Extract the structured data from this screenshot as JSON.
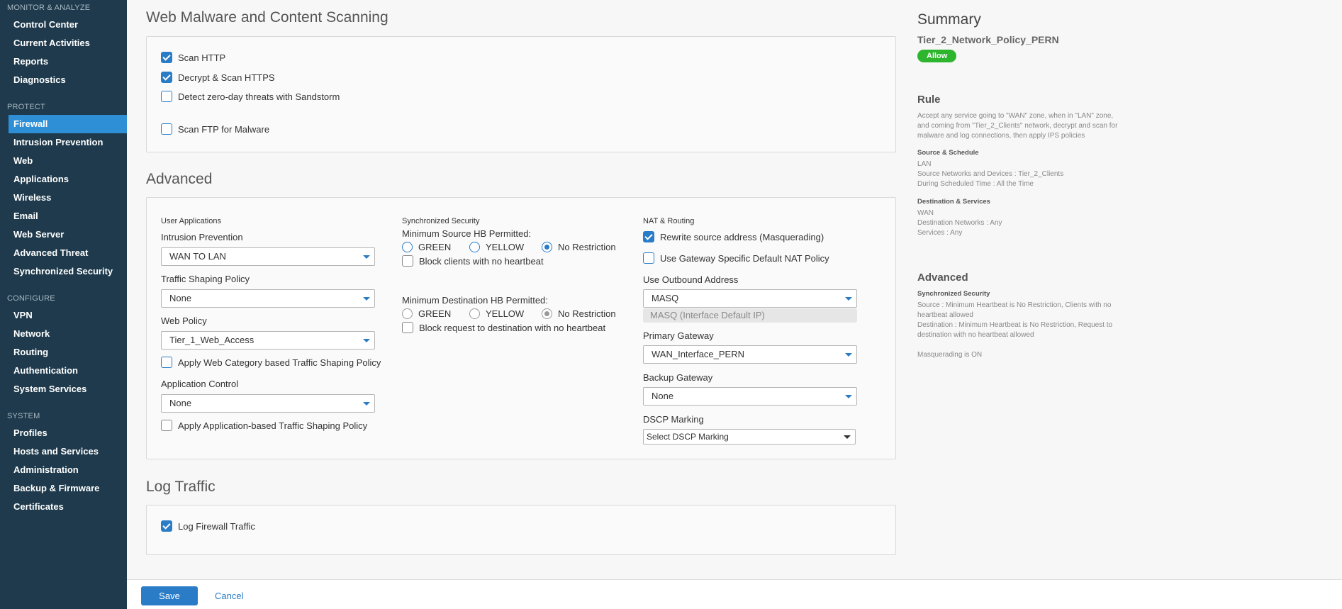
{
  "sidebar": {
    "sections": [
      {
        "title": "MONITOR & ANALYZE",
        "items": [
          "Control Center",
          "Current Activities",
          "Reports",
          "Diagnostics"
        ]
      },
      {
        "title": "PROTECT",
        "items": [
          "Firewall",
          "Intrusion Prevention",
          "Web",
          "Applications",
          "Wireless",
          "Email",
          "Web Server",
          "Advanced Threat",
          "Synchronized Security"
        ]
      },
      {
        "title": "CONFIGURE",
        "items": [
          "VPN",
          "Network",
          "Routing",
          "Authentication",
          "System Services"
        ]
      },
      {
        "title": "SYSTEM",
        "items": [
          "Profiles",
          "Hosts and Services",
          "Administration",
          "Backup & Firmware",
          "Certificates"
        ]
      }
    ],
    "active_item": "Firewall"
  },
  "malware": {
    "title": "Web Malware and Content Scanning",
    "scan_http": {
      "label": "Scan HTTP",
      "checked": true
    },
    "decrypt_https": {
      "label": "Decrypt & Scan HTTPS",
      "checked": true
    },
    "sandstorm": {
      "label": "Detect zero-day threats with Sandstorm",
      "checked": false
    },
    "scan_ftp": {
      "label": "Scan FTP for Malware",
      "checked": false
    }
  },
  "advanced": {
    "title": "Advanced",
    "user_apps": {
      "heading": "User Applications",
      "ips_label": "Intrusion Prevention",
      "ips_value": "WAN TO LAN",
      "shaping_label": "Traffic Shaping Policy",
      "shaping_value": "None",
      "web_policy_label": "Web Policy",
      "web_policy_value": "Tier_1_Web_Access",
      "web_category_shaping": {
        "label": "Apply Web Category based Traffic Shaping Policy",
        "checked": false
      },
      "app_control_label": "Application Control",
      "app_control_value": "None",
      "app_shaping": {
        "label": "Apply Application-based Traffic Shaping Policy",
        "checked": false
      }
    },
    "sync_security": {
      "heading": "Synchronized Security",
      "min_source_label": "Minimum Source HB Permitted:",
      "min_dest_label": "Minimum Destination HB Permitted:",
      "green": "GREEN",
      "yellow": "YELLOW",
      "no_restriction": "No Restriction",
      "block_clients": {
        "label": "Block clients with no heartbeat",
        "checked": false
      },
      "block_request": {
        "label": "Block request to destination with no heartbeat",
        "checked": false
      }
    },
    "nat": {
      "heading": "NAT & Routing",
      "rewrite": {
        "label": "Rewrite source address (Masquerading)",
        "checked": true
      },
      "gateway_nat": {
        "label": "Use Gateway Specific Default NAT Policy",
        "checked": false
      },
      "outbound_label": "Use Outbound Address",
      "outbound_value": "MASQ",
      "outbound_hint": "MASQ (Interface Default IP)",
      "primary_label": "Primary Gateway",
      "primary_value": "WAN_Interface_PERN",
      "backup_label": "Backup Gateway",
      "backup_value": "None",
      "dscp_label": "DSCP Marking",
      "dscp_value": "Select DSCP Marking"
    }
  },
  "log": {
    "title": "Log Traffic",
    "log_firewall": {
      "label": "Log Firewall Traffic",
      "checked": true
    }
  },
  "summary": {
    "title": "Summary",
    "policy_name": "Tier_2_Network_Policy_PERN",
    "badge": "Allow",
    "rule_heading": "Rule",
    "rule_text": "Accept any service going to \"WAN\" zone, when in \"LAN\" zone, and coming from \"Tier_2_Clients\" network, decrypt and scan for malware and log connections, then apply IPS policies",
    "source_heading": "Source & Schedule",
    "source_zone": "LAN",
    "source_networks": "Source Networks and Devices : Tier_2_Clients",
    "schedule": "During Scheduled Time : All the Time",
    "dest_heading": "Destination & Services",
    "dest_zone": "WAN",
    "dest_networks": "Destination Networks : Any",
    "services": "Services : Any",
    "advanced_heading": "Advanced",
    "sync_heading": "Synchronized Security",
    "source_hb": "Source : Minimum Heartbeat is No Restriction, Clients with no heartbeat allowed",
    "dest_hb": "Destination : Minimum Heartbeat is No Restriction, Request to destination with no heartbeat allowed",
    "masq": "Masquerading is ON"
  },
  "footer": {
    "save": "Save",
    "cancel": "Cancel"
  },
  "colors": {
    "sidebar_bg": "#1e3a4c",
    "accent": "#2a7cc7",
    "active_nav": "#2f8fd6",
    "allow_badge": "#2db52d"
  }
}
